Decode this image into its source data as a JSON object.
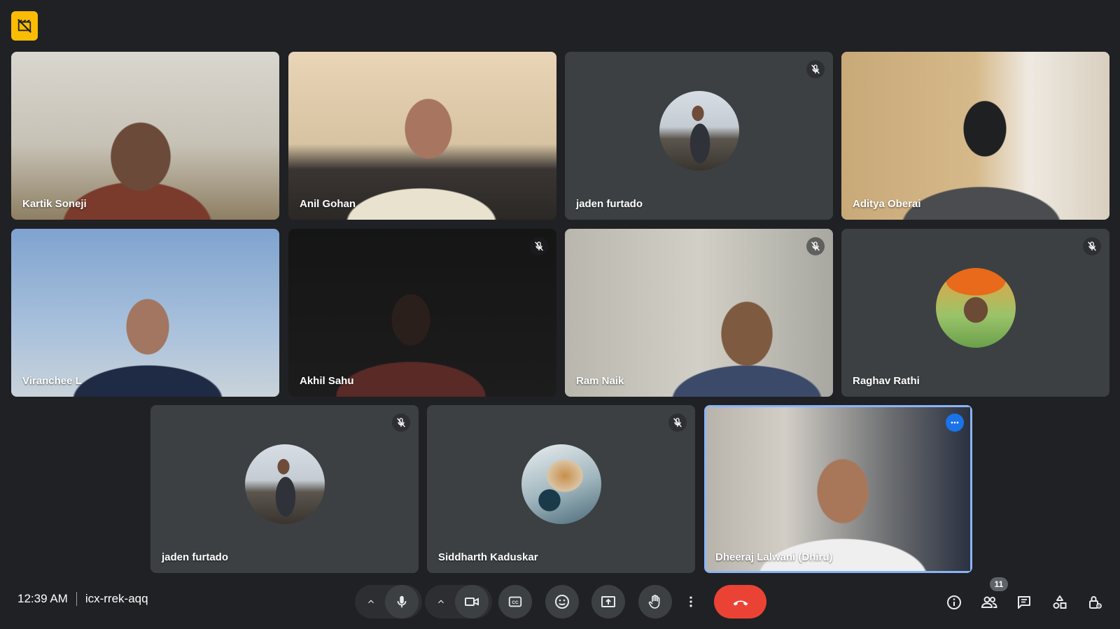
{
  "meeting": {
    "time": "12:39 AM",
    "code": "icx-rrek-aqq",
    "participant_count": "11"
  },
  "recording_badge": {
    "icon": "no-recording-icon",
    "color": "#fbbc04"
  },
  "tiles": [
    {
      "name": "Kartik Soneji",
      "type": "video",
      "muted": false
    },
    {
      "name": "Anil Gohan",
      "type": "video",
      "muted": false
    },
    {
      "name": "jaden furtado",
      "type": "avatar",
      "muted": true
    },
    {
      "name": "Aditya Oberai",
      "type": "video",
      "muted": false
    },
    {
      "name": "Viranchee L",
      "type": "video",
      "muted": false
    },
    {
      "name": "Akhil Sahu",
      "type": "video",
      "muted": true
    },
    {
      "name": "Ram Naik",
      "type": "video",
      "muted": true
    },
    {
      "name": "Raghav Rathi",
      "type": "avatar",
      "muted": true
    },
    {
      "name": "jaden furtado",
      "type": "avatar",
      "muted": true
    },
    {
      "name": "Siddharth Kaduskar",
      "type": "avatar",
      "muted": true
    },
    {
      "name": "Dheeraj Lalwani (Dhiru)",
      "type": "video",
      "muted": false,
      "active_speaker": true
    }
  ],
  "controls": {
    "left": [
      "mic-options-chevron",
      "mic-icon",
      "camera-options-chevron",
      "camera-icon",
      "captions-icon",
      "emoji-icon",
      "present-icon",
      "raise-hand-icon",
      "more-options-icon"
    ],
    "end_call": {
      "icon": "end-call-icon",
      "color": "#ea4335"
    },
    "right": [
      "info-icon",
      "people-icon",
      "chat-icon",
      "activities-icon",
      "host-controls-icon"
    ]
  },
  "colors": {
    "background": "#202124",
    "tile": "#3c4043",
    "active_outline": "#8ab4f8",
    "accent": "#1a73e8"
  }
}
